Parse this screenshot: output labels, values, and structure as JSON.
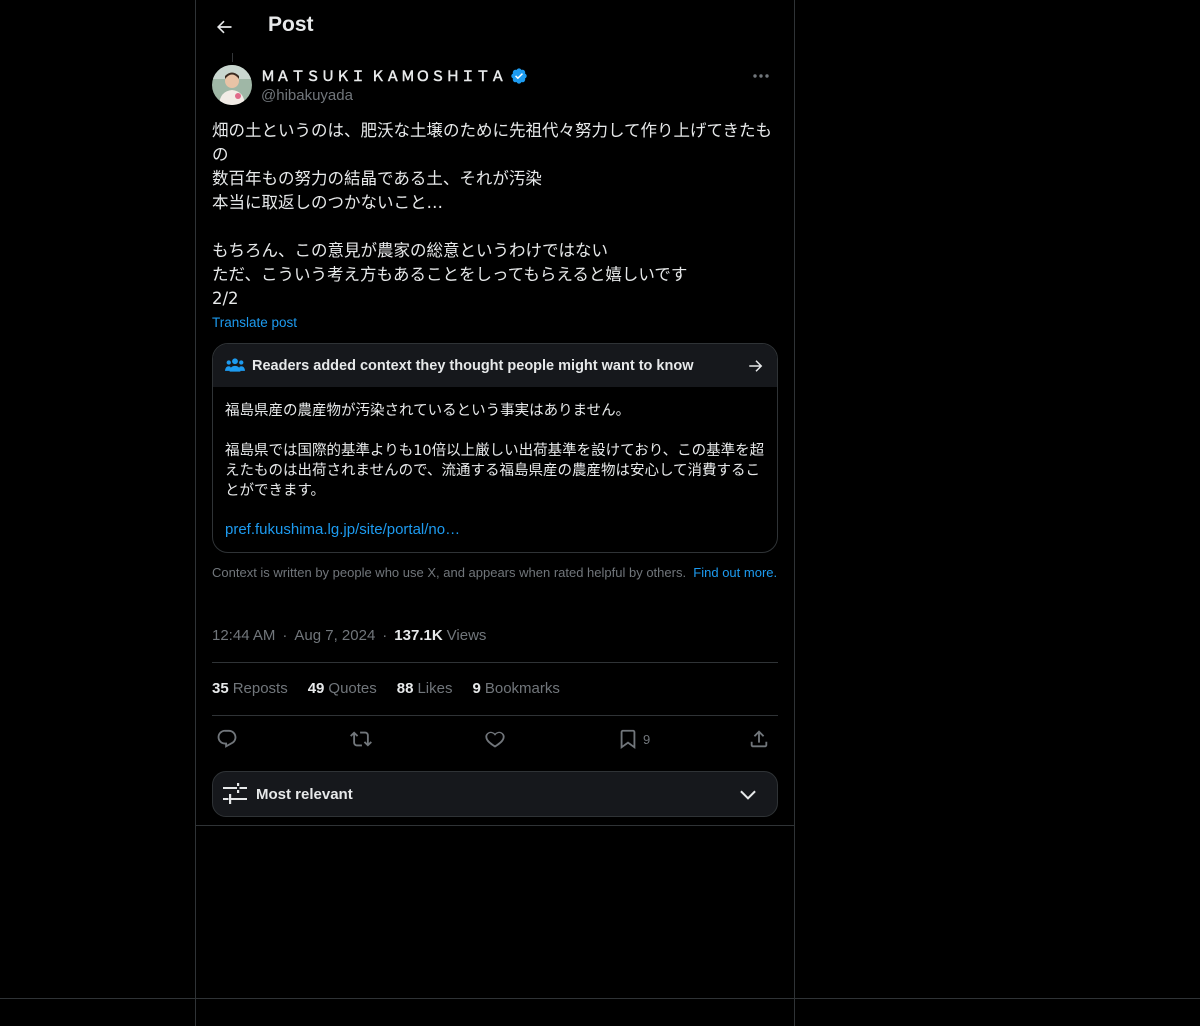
{
  "header": {
    "title": "Post"
  },
  "author": {
    "display_name": "ＭＡＴＳＵＫＩ ＫＡＭＯＳＨＩＴＡ",
    "handle": "@hibakuyada",
    "verified": true
  },
  "post": {
    "text": "畑の土というのは、肥沃な土壌のために先祖代々努力して作り上げてきたもの\n数百年もの努力の結晶である土、それが汚染\n本当に取返しのつかないこと…\n\nもちろん、この意見が農家の総意というわけではない\nただ、こういう考え方もあることをしってもらえると嬉しいです\n2/2",
    "translate_label": "Translate post"
  },
  "community_note": {
    "title": "Readers added context they thought people might want to know",
    "paragraph_1": "福島県産の農産物が汚染されているという事実はありません。",
    "paragraph_2": "福島県では国際的基準よりも10倍以上厳しい出荷基準を設けており、この基準を超えたものは出荷されませんので、流通する福島県産の農産物は安心して消費することができます。",
    "link": "pref.fukushima.lg.jp/site/portal/no…",
    "footer_text": "Context is written by people who use X, and appears when rated helpful by others.",
    "footer_link": "Find out more."
  },
  "meta": {
    "time": "12:44 AM",
    "date": "Aug 7, 2024",
    "views_count": "137.1K",
    "views_label": "Views"
  },
  "stats": {
    "reposts": {
      "count": "35",
      "label": "Reposts"
    },
    "quotes": {
      "count": "49",
      "label": "Quotes"
    },
    "likes": {
      "count": "88",
      "label": "Likes"
    },
    "bookmarks": {
      "count": "9",
      "label": "Bookmarks"
    }
  },
  "actions": {
    "bookmark_count": "9",
    "icons": [
      "reply-icon",
      "repost-icon",
      "like-icon",
      "bookmark-icon",
      "share-icon"
    ]
  },
  "sort": {
    "label": "Most relevant"
  },
  "colors": {
    "background": "#000000",
    "text": "#e7e9ea",
    "muted": "#71767b",
    "accent": "#1d9bf0",
    "border": "#2f3336",
    "card": "#16181c"
  }
}
